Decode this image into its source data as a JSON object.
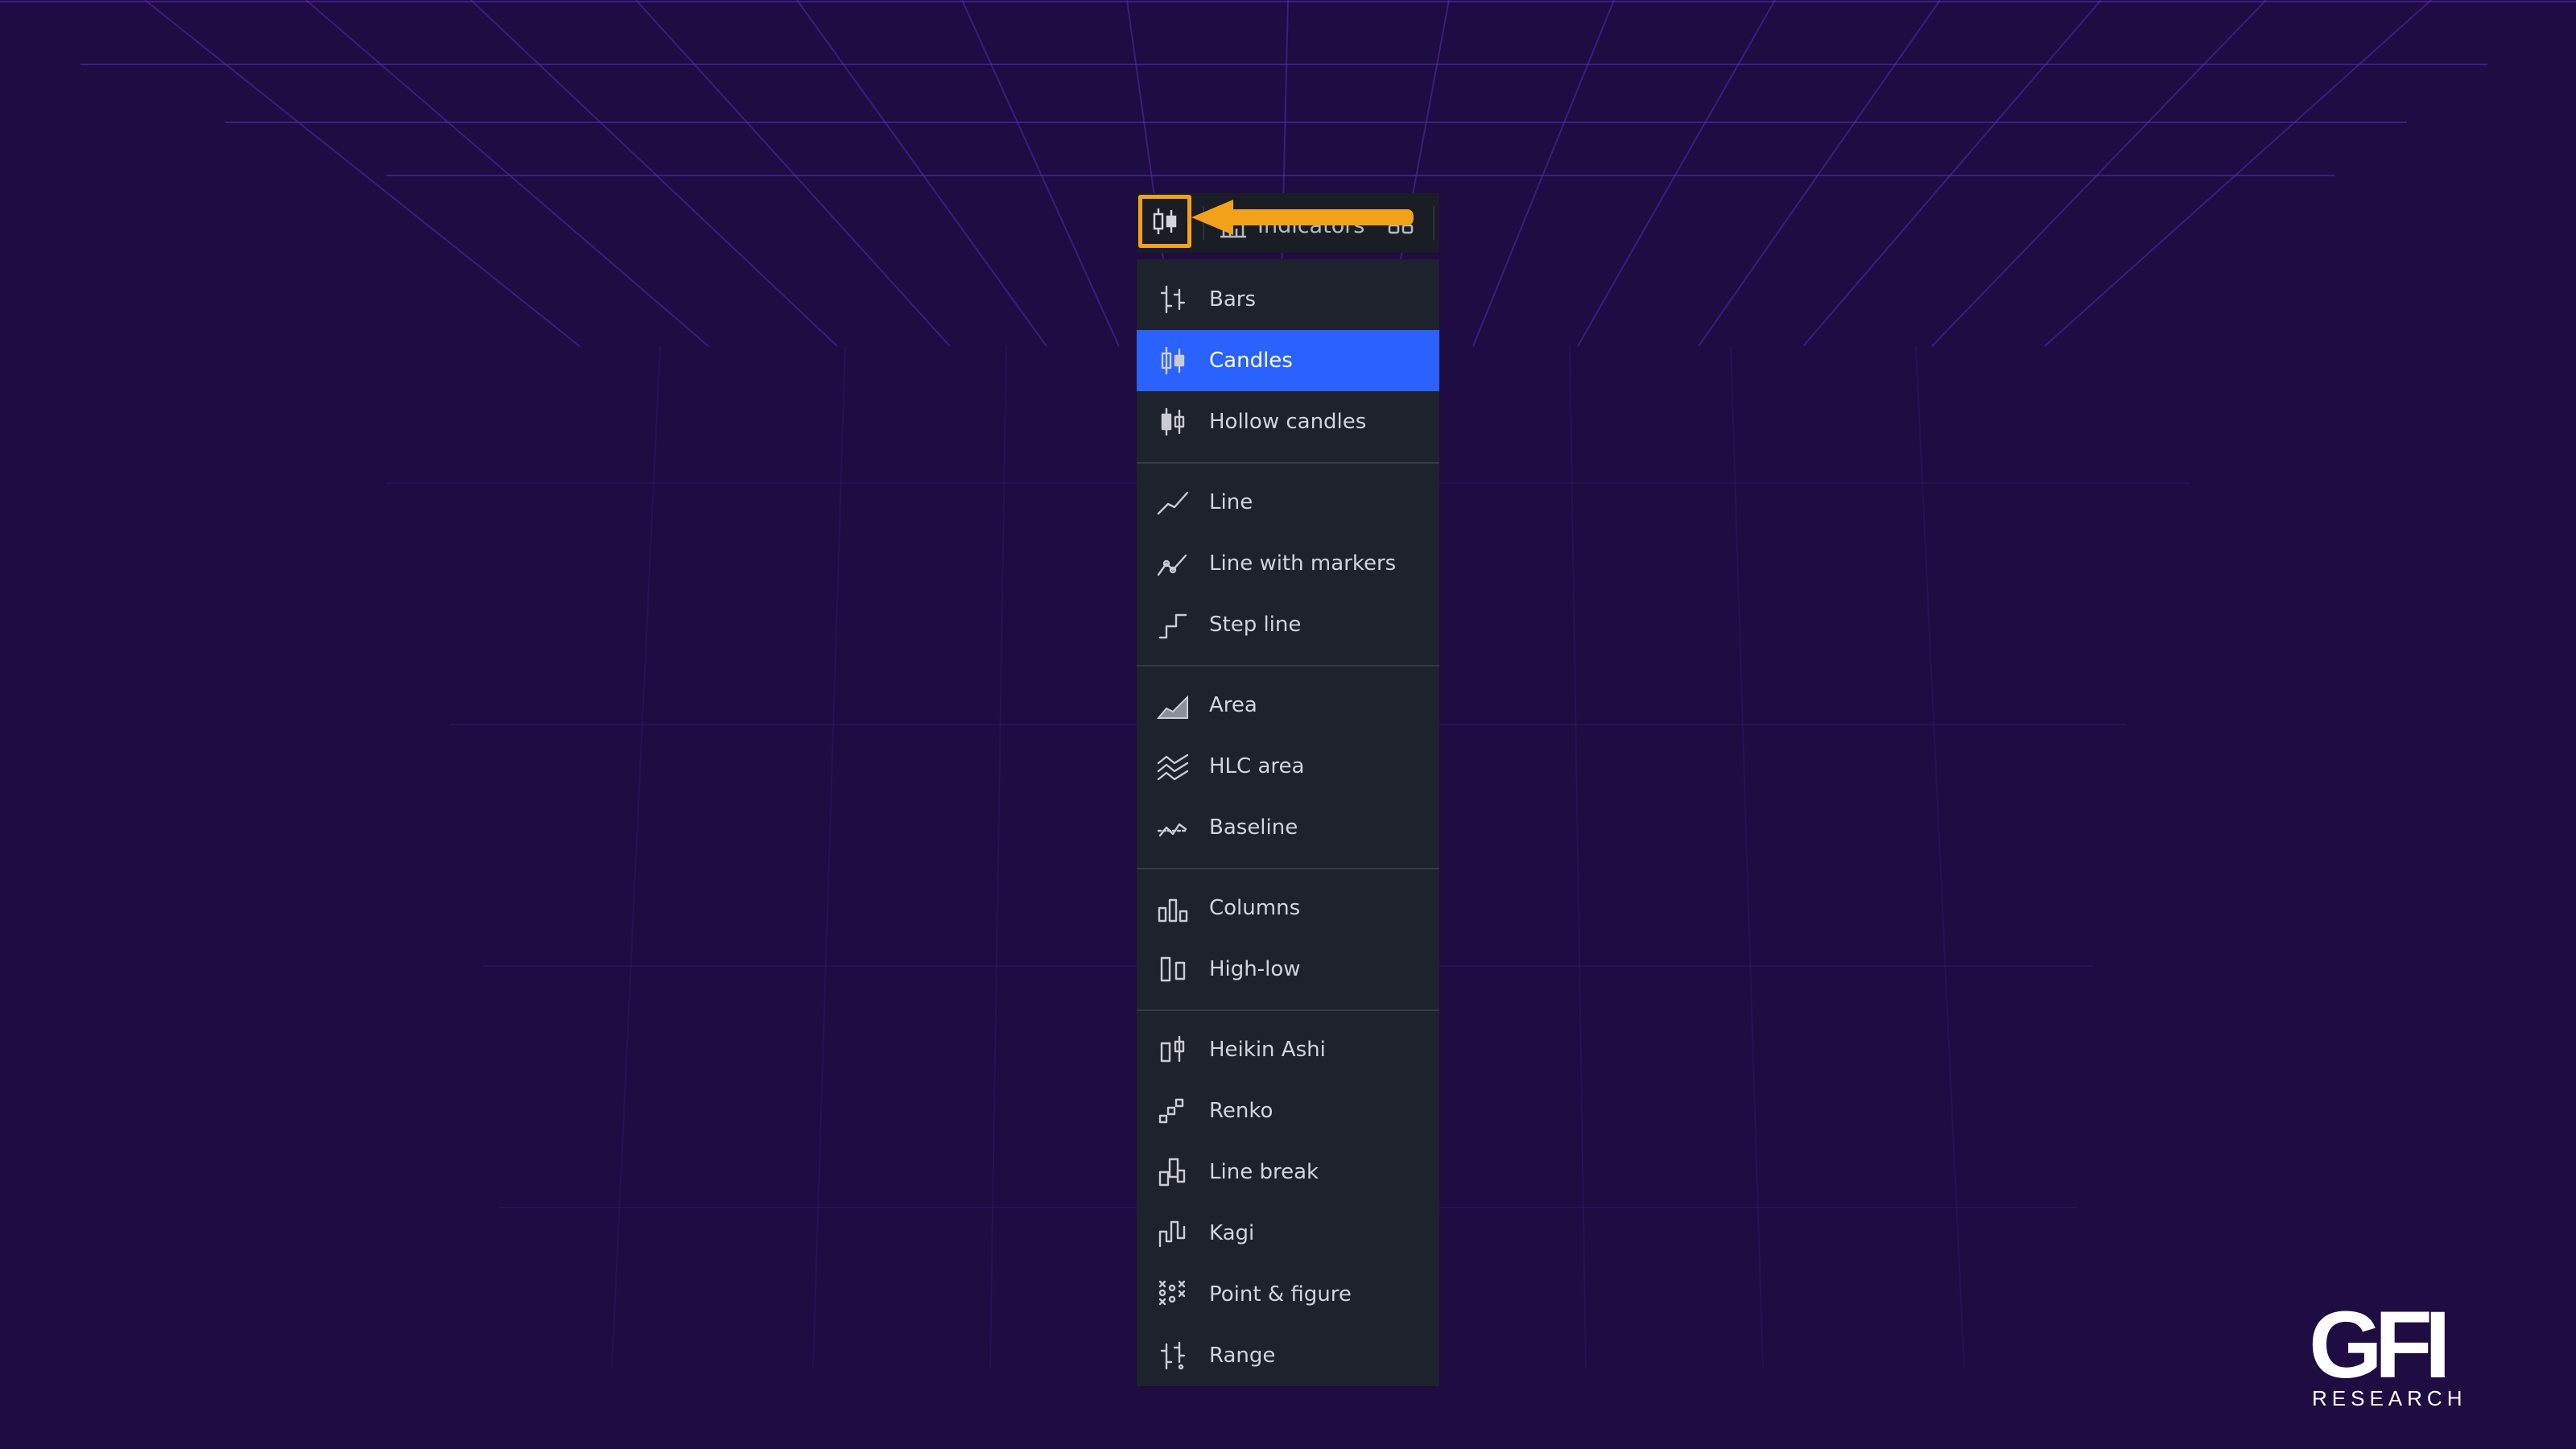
{
  "toolbar": {
    "chart_type_icon": "candles-icon",
    "indicators_label": "Indicators",
    "accent_color": "#f2a21a"
  },
  "menu": {
    "groups": [
      [
        {
          "label": "Bars",
          "icon": "bars-icon"
        },
        {
          "label": "Candles",
          "icon": "candles-icon",
          "selected": true
        },
        {
          "label": "Hollow candles",
          "icon": "hollow-candles-icon"
        }
      ],
      [
        {
          "label": "Line",
          "icon": "line-icon"
        },
        {
          "label": "Line with markers",
          "icon": "line-with-markers-icon"
        },
        {
          "label": "Step line",
          "icon": "step-line-icon"
        }
      ],
      [
        {
          "label": "Area",
          "icon": "area-icon"
        },
        {
          "label": "HLC area",
          "icon": "hlc-area-icon"
        },
        {
          "label": "Baseline",
          "icon": "baseline-icon"
        }
      ],
      [
        {
          "label": "Columns",
          "icon": "columns-icon"
        },
        {
          "label": "High-low",
          "icon": "high-low-icon"
        }
      ],
      [
        {
          "label": "Heikin Ashi",
          "icon": "heikin-ashi-icon"
        },
        {
          "label": "Renko",
          "icon": "renko-icon"
        },
        {
          "label": "Line break",
          "icon": "line-break-icon"
        },
        {
          "label": "Kagi",
          "icon": "kagi-icon"
        },
        {
          "label": "Point & figure",
          "icon": "point-and-figure-icon"
        },
        {
          "label": "Range",
          "icon": "range-icon"
        }
      ]
    ],
    "selected_color": "#2962ff",
    "background_color": "#1e222d"
  },
  "logo": {
    "mark": "GFI",
    "subtitle": "RESEARCH"
  },
  "colors": {
    "background": "#1e0c42",
    "grid_lines": "#5a2bb0"
  }
}
